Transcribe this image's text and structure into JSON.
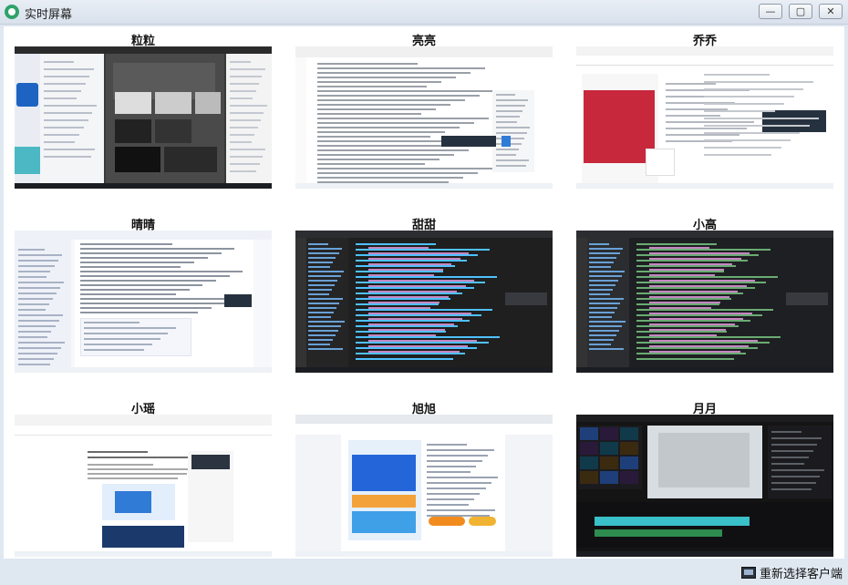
{
  "window": {
    "title": "实时屏幕",
    "controls": {
      "minimize": "—",
      "maximize": "▢",
      "close": "✕"
    }
  },
  "clients": [
    {
      "name": "粒粒",
      "theme": "photoshop",
      "colors": {
        "bg": "#3a3a3a",
        "panel": "#f4f5f7",
        "accent": "#2f7bd6"
      }
    },
    {
      "name": "亮亮",
      "theme": "document",
      "colors": {
        "bg": "#ffffff",
        "panel": "#f2f2f2",
        "accent": "#2f7bd6"
      }
    },
    {
      "name": "乔乔",
      "theme": "browser-red",
      "colors": {
        "bg": "#ffffff",
        "panel": "#f3f3f3",
        "accent": "#c8283c"
      }
    },
    {
      "name": "晴晴",
      "theme": "chat-doc",
      "colors": {
        "bg": "#f7f8fb",
        "panel": "#eef1f7",
        "accent": "#3b6fe0"
      }
    },
    {
      "name": "甜甜",
      "theme": "code-editor",
      "colors": {
        "bg": "#1f1f1f",
        "panel": "#252526",
        "accent": "#4fc1ff"
      }
    },
    {
      "name": "小高",
      "theme": "code-editor",
      "colors": {
        "bg": "#1e1f22",
        "panel": "#2b2d30",
        "accent": "#6aab73"
      }
    },
    {
      "name": "小瑶",
      "theme": "article",
      "colors": {
        "bg": "#ffffff",
        "panel": "#f6f6f6",
        "accent": "#2f7bd6"
      }
    },
    {
      "name": "旭旭",
      "theme": "shop-page",
      "colors": {
        "bg": "#f2f4f7",
        "panel": "#ffffff",
        "accent": "#2466d9"
      }
    },
    {
      "name": "月月",
      "theme": "video-editor",
      "colors": {
        "bg": "#141414",
        "panel": "#1d1d1f",
        "accent": "#3ac0c8"
      }
    }
  ],
  "footer": {
    "reselect_label": "重新选择客户端",
    "icon": "monitor-icon"
  }
}
